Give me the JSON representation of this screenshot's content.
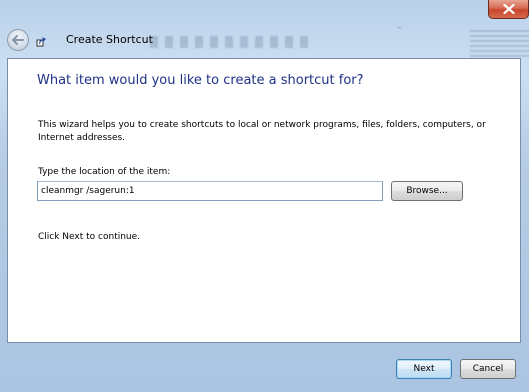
{
  "window": {
    "title": "Create Shortcut"
  },
  "wizard": {
    "heading": "What item would you like to create a shortcut for?",
    "description": "This wizard helps you to create shortcuts to local or network programs, files, folders, computers, or Internet addresses.",
    "location_label": "Type the location of the item:",
    "location_value": "cleanmgr /sagerun:1",
    "browse_label": "Browse...",
    "continue_text": "Click Next to continue."
  },
  "footer": {
    "next_label": "Next",
    "cancel_label": "Cancel"
  },
  "icons": {
    "close": "close-icon",
    "back": "back-arrow-icon",
    "shortcut": "shortcut-arrow-icon"
  },
  "colors": {
    "heading": "#1e3287",
    "glass": "#b9d1ea",
    "close_button": "#c7462c"
  }
}
